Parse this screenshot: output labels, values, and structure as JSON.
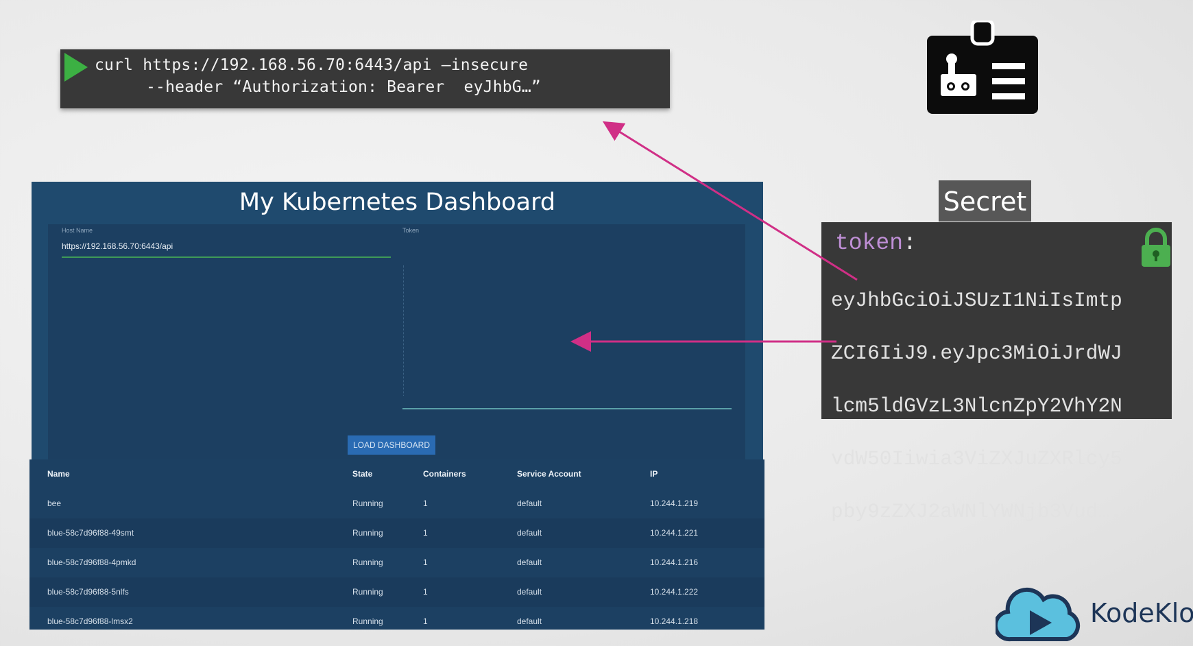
{
  "terminal": {
    "line1": "curl https://192.168.56.70:6443/api –insecure",
    "line2": "--header “Authorization: Bearer  eyJhbG…”"
  },
  "dashboard": {
    "title": "My Kubernetes Dashboard",
    "host_label": "Host Name",
    "host_value": "https://192.168.56.70:6443/api",
    "token_label": "Token",
    "load_button": "LOAD DASHBOARD"
  },
  "table": {
    "columns": [
      "Name",
      "State",
      "Containers",
      "Service Account",
      "IP"
    ],
    "rows": [
      [
        "bee",
        "Running",
        "1",
        "default",
        "10.244.1.219"
      ],
      [
        "blue-58c7d96f88-49smt",
        "Running",
        "1",
        "default",
        "10.244.1.221"
      ],
      [
        "blue-58c7d96f88-4pmkd",
        "Running",
        "1",
        "default",
        "10.244.1.216"
      ],
      [
        "blue-58c7d96f88-5nlfs",
        "Running",
        "1",
        "default",
        "10.244.1.222"
      ],
      [
        "blue-58c7d96f88-lmsx2",
        "Running",
        "1",
        "default",
        "10.244.1.218"
      ]
    ]
  },
  "secret": {
    "tab": "Secret",
    "key": "token",
    "value_lines": [
      "eyJhbGciOiJSUzI1NiIsImtp",
      "ZCI6IiJ9.eyJpc3MiOiJrdWJ",
      "lcm5ldGVzL3NlcnZpY2VhY2N",
      "vdW50Iiwia3ViZXJuZXRlcy5",
      "pby9zZXJ2aWNlYWNjb3Vud…."
    ]
  },
  "logo": {
    "text": "KodeKlou"
  },
  "colors": {
    "arrow": "#d02f86",
    "terminal_bg": "#383838",
    "dashboard_bg": "#1f4a6e",
    "play_green": "#3cb043",
    "lock_green": "#4caf50"
  }
}
